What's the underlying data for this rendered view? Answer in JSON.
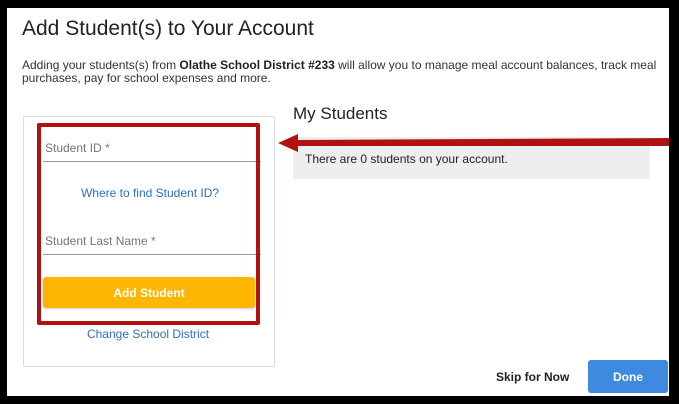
{
  "dialog": {
    "title": "Add Student(s) to Your Account",
    "desc_prefix": "Adding your students(s) from ",
    "district_name": "Olathe School District #233",
    "desc_suffix": " will allow you to manage meal account balances, track meal purchases, pay for school expenses and more."
  },
  "form": {
    "student_id_placeholder": "Student ID *",
    "find_student_id_link": "Where to find Student ID?",
    "last_name_placeholder": "Student Last Name *",
    "add_student_label": "Add Student",
    "change_district_link": "Change School District"
  },
  "my_students": {
    "heading": "My Students",
    "empty_message": "There are 0 students on your account."
  },
  "footer": {
    "skip_label": "Skip for Now",
    "done_label": "Done"
  },
  "colors": {
    "highlight": "#b01212",
    "add_button": "#ffb600",
    "done_button": "#3d8ae0",
    "link": "#2f6fbd"
  }
}
